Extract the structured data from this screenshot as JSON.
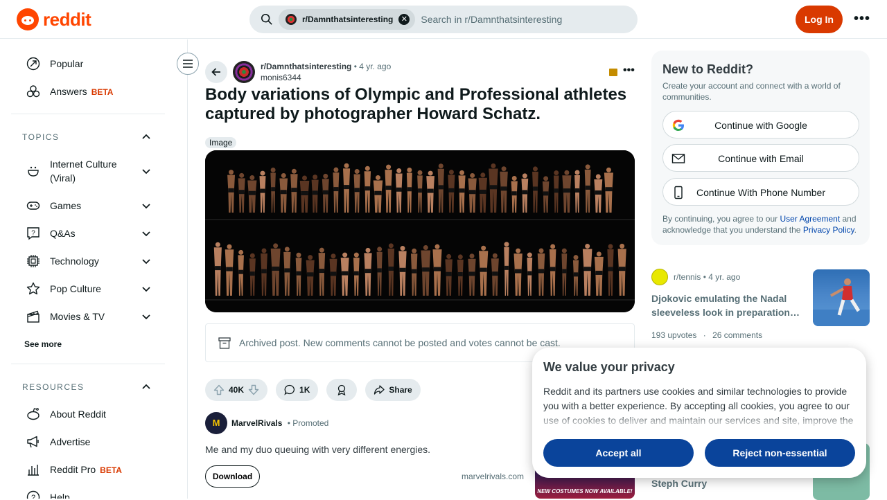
{
  "header": {
    "logo_text": "reddit",
    "search_chip": "r/Damnthatsinteresting",
    "search_placeholder": "Search in r/Damnthatsinteresting",
    "login_label": "Log In",
    "more_label": "•••"
  },
  "sidebar": {
    "top_items": [
      {
        "label": "Popular",
        "icon": "popular-icon"
      },
      {
        "label": "Answers",
        "badge": "BETA",
        "icon": "answers-icon"
      }
    ],
    "topics_heading": "TOPICS",
    "topics": [
      {
        "label": "Internet Culture (Viral)",
        "icon": "smiley-icon"
      },
      {
        "label": "Games",
        "icon": "gamepad-icon"
      },
      {
        "label": "Q&As",
        "icon": "question-icon"
      },
      {
        "label": "Technology",
        "icon": "chip-icon"
      },
      {
        "label": "Pop Culture",
        "icon": "star-icon"
      },
      {
        "label": "Movies & TV",
        "icon": "clapperboard-icon"
      }
    ],
    "see_more": "See more",
    "resources_heading": "RESOURCES",
    "resources": [
      {
        "label": "About Reddit",
        "icon": "reddit-icon"
      },
      {
        "label": "Advertise",
        "icon": "megaphone-icon"
      },
      {
        "label": "Reddit Pro",
        "badge": "BETA",
        "icon": "bar-chart-icon"
      },
      {
        "label": "Help",
        "icon": "help-icon"
      }
    ]
  },
  "post": {
    "subreddit": "r/Damnthatsinteresting",
    "age": "• 4 yr. ago",
    "author": "monis6344",
    "title": "Body variations of Olympic and Professional athletes captured by photographer Howard Schatz.",
    "flair": "Image",
    "archived_notice": "Archived post. New comments cannot be posted and votes cannot be cast.",
    "votes": "40K",
    "comments": "1K",
    "share_label": "Share"
  },
  "promoted": {
    "name": "MarvelRivals",
    "tag": "• Promoted",
    "text": "Me and my duo queuing with very different energies.",
    "download_label": "Download",
    "domain": "marvelrivals.com",
    "image_caption": "NEW COSTUMES NOW AVAILABLE!"
  },
  "signup": {
    "title": "New to Reddit?",
    "description": "Create your account and connect with a world of communities.",
    "google_label": "Continue with Google",
    "email_label": "Continue with Email",
    "phone_label": "Continue With Phone Number",
    "terms_prefix": "By continuing, you agree to our ",
    "user_agreement": "User Agreement",
    "terms_middle": " and acknowledge that you understand the ",
    "privacy_policy": "Privacy Policy",
    "terms_suffix": "."
  },
  "related": {
    "subreddit": "r/tennis",
    "age": "• 4 yr. ago",
    "title": "Djokovic emulating the Nadal sleeveless look in preparation…",
    "upvotes": "193 upvotes",
    "separator": "·",
    "comments": "26 comments",
    "next_title": "Steph Curry"
  },
  "cookie": {
    "title": "We value your privacy",
    "text": "Reddit and its partners use cookies and similar technologies to provide you with a better experience. By accepting all cookies, you agree to our use of cookies to deliver and maintain our services and site, improve the",
    "accept_label": "Accept all",
    "reject_label": "Reject non-essential"
  },
  "colors": {
    "brand": "#ff4500",
    "login_button": "#d93900",
    "cookie_button": "#0a449b",
    "link": "#0045ac"
  }
}
